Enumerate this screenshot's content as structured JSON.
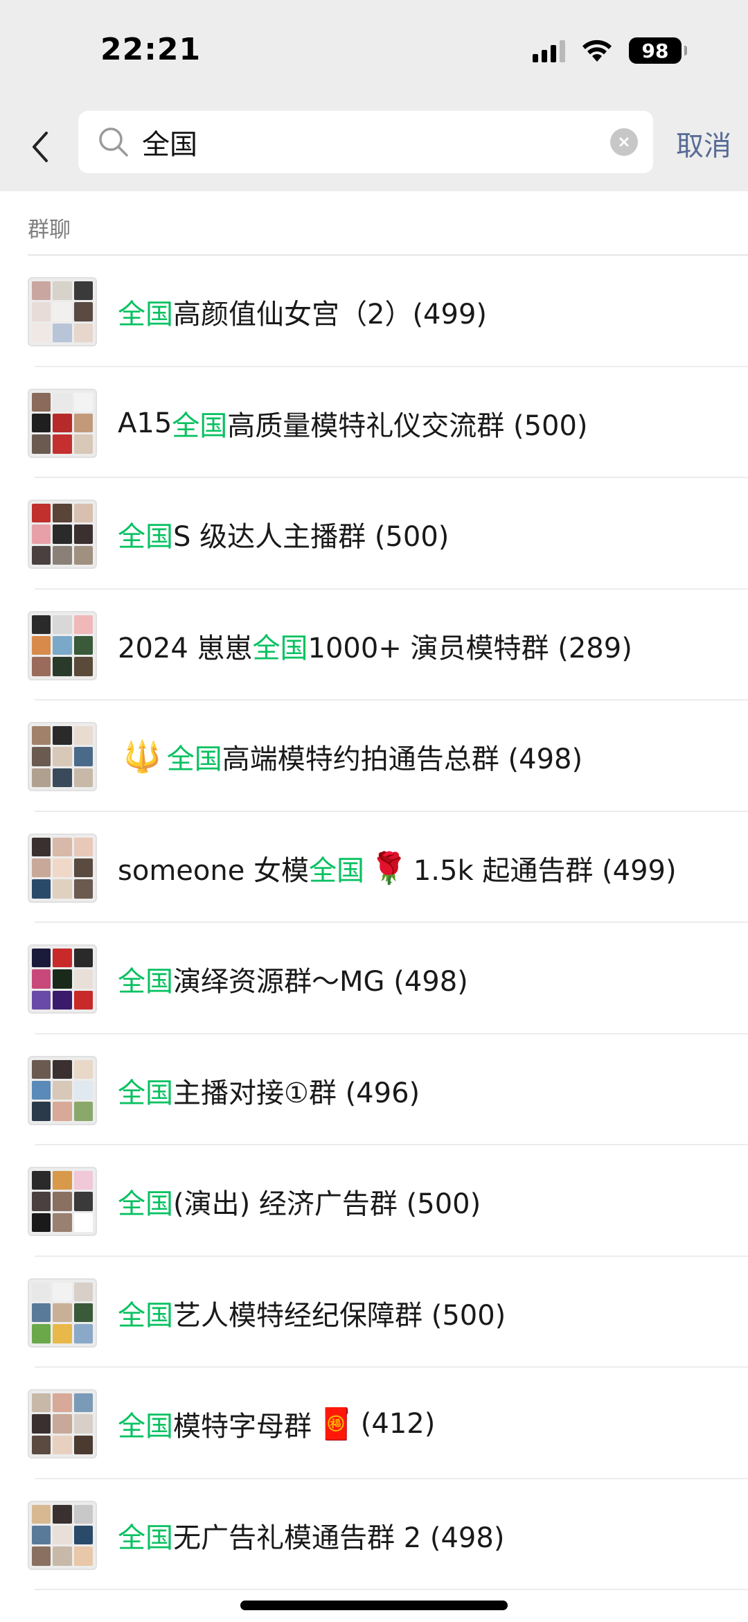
{
  "status_bar": {
    "time": "22:21",
    "battery": "98"
  },
  "search": {
    "query": "全国",
    "cancel_label": "取消"
  },
  "section": {
    "title": "群聊"
  },
  "results": [
    {
      "highlight": "全国",
      "pre": "",
      "post": "高颜值仙女宫（2）(499)",
      "emoji": "",
      "after_emoji": "",
      "colors": [
        "#c9a7a0",
        "#d7d2ca",
        "#3a3a3a",
        "#e8dcd8",
        "#f2f0ee",
        "#5a4a42",
        "#f0e8e4",
        "#b8c4d8",
        "#e6d6cc"
      ]
    },
    {
      "highlight": "全国",
      "pre": "A15 ",
      "post": "高质量模特礼仪交流群 (500)",
      "emoji": "",
      "after_emoji": "",
      "colors": [
        "#8a6a5a",
        "#e9e9e9",
        "#f3f3f3",
        "#1f1f1f",
        "#b62a2a",
        "#c29a7a",
        "#6a5a50",
        "#c43030",
        "#d8c8b8"
      ]
    },
    {
      "highlight": "全国",
      "pre": "",
      "post": "S 级达人主播群 (500)",
      "emoji": "",
      "after_emoji": "",
      "colors": [
        "#c0302c",
        "#5a4438",
        "#d8c0b0",
        "#e8a0a8",
        "#2a2a2a",
        "#3a3030",
        "#4a4040",
        "#8a8078",
        "#a09080"
      ]
    },
    {
      "highlight": "全国",
      "pre": "2024 崽崽",
      "post": "1000+ 演员模特群 (289)",
      "emoji": "",
      "after_emoji": "",
      "colors": [
        "#2a2a2a",
        "#d8d8d8",
        "#f0b8b8",
        "#d88a4a",
        "#7aa8c8",
        "#3a5a3a",
        "#9a6a5a",
        "#2a3a2a",
        "#5a4a3a"
      ]
    },
    {
      "highlight": "全国",
      "pre": "",
      "post": "高端模特约拍通告总群 (498)",
      "emoji": "🔱",
      "emoji_first": true,
      "after_emoji": "",
      "colors": [
        "#a0826a",
        "#2a2a2a",
        "#e8dcd0",
        "#6a5a50",
        "#d8c8b8",
        "#4a6a8a",
        "#b0a090",
        "#3a4a5a",
        "#c8b8a8"
      ]
    },
    {
      "highlight": "全国",
      "pre": "someone 女模",
      "post": "",
      "emoji": "🌹",
      "after_emoji": "1.5k 起通告群 (499)",
      "colors": [
        "#3a3030",
        "#d8b8a8",
        "#e8c8b8",
        "#c8a898",
        "#f0d8c8",
        "#5a4a40",
        "#2a4a6a",
        "#e0d0c0",
        "#6a5a50"
      ]
    },
    {
      "highlight": "全国",
      "pre": "",
      "post": "演绎资源群～MG (498)",
      "emoji": "",
      "after_emoji": "",
      "colors": [
        "#1a1a3a",
        "#c82a2a",
        "#2a2a2a",
        "#c8487a",
        "#1a2a1a",
        "#e8e0d8",
        "#6a4aa8",
        "#3a1a6a",
        "#c82a2a"
      ]
    },
    {
      "highlight": "全国",
      "pre": "",
      "post": "主播对接①群 (496)",
      "emoji": "",
      "after_emoji": "",
      "colors": [
        "#6a5a50",
        "#3a3030",
        "#e8d8c8",
        "#5a8ab8",
        "#d8c8b8",
        "#e0e8f0",
        "#2a3a4a",
        "#d8a898",
        "#8aa86a"
      ]
    },
    {
      "highlight": "全国",
      "pre": "",
      "post": "(演出) 经济广告群 (500)",
      "emoji": "",
      "after_emoji": "",
      "colors": [
        "#2a2a2a",
        "#d89a4a",
        "#f0c8d8",
        "#4a4040",
        "#8a7060",
        "#3a3a3a",
        "#1a1a1a",
        "#9a8070",
        "#ffffff"
      ]
    },
    {
      "highlight": "全国",
      "pre": "",
      "post": "艺人模特经纪保障群 (500)",
      "emoji": "",
      "after_emoji": "",
      "colors": [
        "#e8e8e8",
        "#f2f2f2",
        "#d8d0c8",
        "#5a7a9a",
        "#c8b098",
        "#3a5a3a",
        "#6aa84a",
        "#e8b84a",
        "#8aa8c8"
      ]
    },
    {
      "highlight": "全国",
      "pre": "",
      "post": "模特字母群",
      "emoji": "🧧",
      "after_emoji": "(412)",
      "colors": [
        "#c8b8a8",
        "#d8a898",
        "#7a9ab8",
        "#3a3030",
        "#c8a898",
        "#d8d0c8",
        "#5a4a40",
        "#e8d0c0",
        "#4a3a30"
      ]
    },
    {
      "highlight": "全国",
      "pre": "",
      "post": "无广告礼模通告群 2 (498)",
      "emoji": "",
      "after_emoji": "",
      "colors": [
        "#d8b890",
        "#3a3030",
        "#c8c8c8",
        "#5a7a9a",
        "#e8e0d8",
        "#2a4a6a",
        "#8a7060",
        "#c8b8a8",
        "#e8c8a8"
      ]
    }
  ]
}
